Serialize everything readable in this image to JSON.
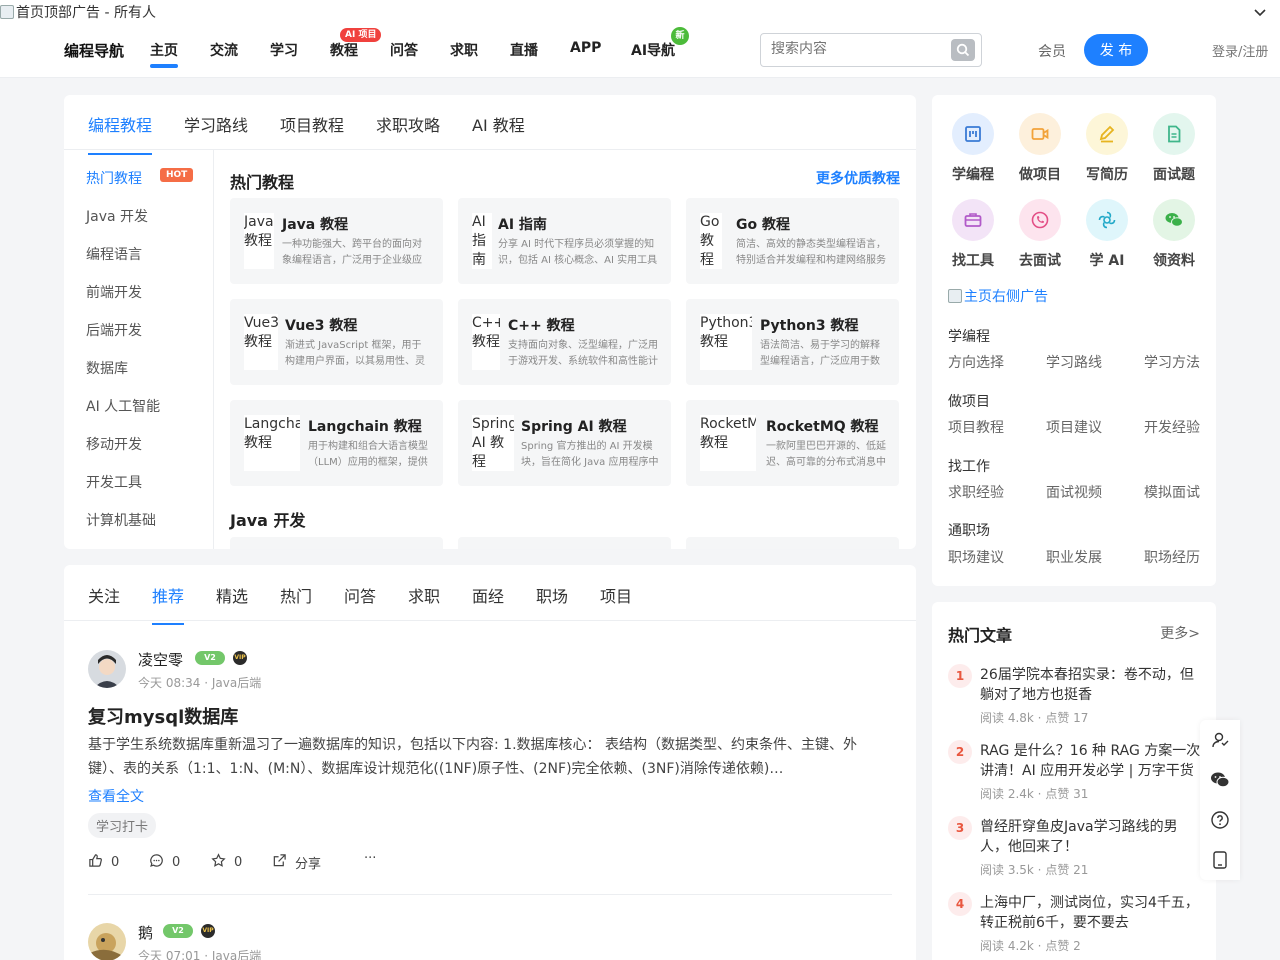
{
  "header": {
    "top_ad_alt": "首页顶部广告 - 所有人",
    "logo": "编程导航",
    "nav": [
      {
        "label": "主页",
        "active": true
      },
      {
        "label": "交流"
      },
      {
        "label": "学习"
      },
      {
        "label": "教程",
        "badge": "AI 项目"
      },
      {
        "label": "问答"
      },
      {
        "label": "求职"
      },
      {
        "label": "直播"
      },
      {
        "label": "APP"
      },
      {
        "label": "AI导航",
        "badge": "新"
      }
    ],
    "search_placeholder": "搜索内容",
    "vip_label": "会员",
    "publish_label": "发 布",
    "login_label": "登录/注册"
  },
  "tutorial": {
    "tabs": [
      "编程教程",
      "学习路线",
      "项目教程",
      "求职攻略",
      "AI 教程"
    ],
    "sidebar": [
      "热门教程",
      "Java 开发",
      "编程语言",
      "前端开发",
      "后端开发",
      "数据库",
      "AI 人工智能",
      "移动开发",
      "开发工具",
      "计算机基础"
    ],
    "hot_badge": "HOT",
    "section_hot": "热门教程",
    "section_java": "Java 开发",
    "more_label": "更多优质教程",
    "items": [
      {
        "thumb": "Java 教程",
        "name": "Java 教程",
        "desc": "一种功能强大、跨平台的面向对象编程语言，广泛用于企业级应用开发"
      },
      {
        "thumb": "AI 指南",
        "name": "AI 指南",
        "desc": "分享 AI 时代下程序员必须掌握的知识，包括 AI 核心概念、AI 实用工具"
      },
      {
        "thumb": "Go 教程",
        "name": "Go 教程",
        "desc": "简洁、高效的静态类型编程语言，特别适合并发编程和构建网络服务"
      },
      {
        "thumb": "Vue3 教程",
        "name": "Vue3 教程",
        "desc": "渐进式 JavaScript 框架，用于构建用户界面，以其易用性、灵活性著称"
      },
      {
        "thumb": "C++ 教程",
        "name": "C++ 教程",
        "desc": "支持面向对象、泛型编程，广泛用于游戏开发、系统软件和高性能计算"
      },
      {
        "thumb": "Python3 教程",
        "name": "Python3 教程",
        "desc": "语法简洁、易于学习的解释型编程语言，广泛应用于数据分析等领域"
      },
      {
        "thumb": "Langchain 教程",
        "name": "Langchain 教程",
        "desc": "用于构建和组合大语言模型（LLM）应用的框架，提供丰富的组件"
      },
      {
        "thumb": "Spring AI 教程",
        "name": "Spring AI 教程",
        "desc": "Spring 官方推出的 AI 开发模块，旨在简化 Java 应用程序中的 AI 集成"
      },
      {
        "thumb": "RocketMQ 教程",
        "name": "RocketMQ 教程",
        "desc": "一款阿里巴巴开源的、低延迟、高可靠的分布式消息中间件"
      }
    ]
  },
  "feed": {
    "tabs": [
      "关注",
      "推荐",
      "精选",
      "热门",
      "问答",
      "求职",
      "面经",
      "职场",
      "项目"
    ],
    "posts": [
      {
        "author": "凌空零",
        "level": "V2",
        "vip": "VIP",
        "time": "今天 08:34",
        "category": "Java后端",
        "title": "复习mysql数据库",
        "body": "基于学生系统数据库重新温习了一遍数据库的知识，包括以下内容: 1.数据库核心： 表结构（数据类型、约束条件、主键、外键）、表的关系（1:1、1:N、(M:N）、数据库设计规范化((1NF)原子性、(2NF)完全依赖、(3NF)消除传递依赖)…",
        "read_more": "查看全文",
        "tag": "学习打卡",
        "likes": "0",
        "comments": "0",
        "stars": "0",
        "share": "分享",
        "more": "···"
      },
      {
        "author": "鹅",
        "level": "V2",
        "vip": "VIP",
        "time": "今天 07:01",
        "category": "Java后端"
      }
    ],
    "meta_sep": "·"
  },
  "quick": {
    "icons": [
      {
        "label": "学编程",
        "icon": "board-icon",
        "bg": "#e3eefe",
        "fg": "#3a7bd5"
      },
      {
        "label": "做项目",
        "icon": "video-icon",
        "bg": "#fdf0dc",
        "fg": "#f2a33a"
      },
      {
        "label": "写简历",
        "icon": "pen-icon",
        "bg": "#fdf6d8",
        "fg": "#e7b421"
      },
      {
        "label": "面试题",
        "icon": "doc-icon",
        "bg": "#e3f6ee",
        "fg": "#3fb68b"
      },
      {
        "label": "找工具",
        "icon": "toolbox-icon",
        "bg": "#f3e4f7",
        "fg": "#b15ac9"
      },
      {
        "label": "去面试",
        "icon": "phone-icon",
        "bg": "#fde4ee",
        "fg": "#e34f86"
      },
      {
        "label": "学 AI",
        "icon": "ai-icon",
        "bg": "#dff6fb",
        "fg": "#23a9c8"
      },
      {
        "label": "领资料",
        "icon": "wechat-icon",
        "bg": "#e3f5e5",
        "fg": "#3bb04a"
      }
    ],
    "right_ad_alt": "主页右侧广告",
    "groups": [
      {
        "title": "学编程",
        "links": [
          "方向选择",
          "学习路线",
          "学习方法"
        ]
      },
      {
        "title": "做项目",
        "links": [
          "项目教程",
          "项目建议",
          "开发经验"
        ]
      },
      {
        "title": "找工作",
        "links": [
          "求职经验",
          "面试视频",
          "模拟面试"
        ]
      },
      {
        "title": "通职场",
        "links": [
          "职场建议",
          "职业发展",
          "职场经历"
        ]
      }
    ]
  },
  "hot": {
    "title": "热门文章",
    "more": "更多>",
    "articles": [
      {
        "rank": "1",
        "title": "26届学院本春招实录：卷不动，但躺对了地方也挺香",
        "reads": "阅读 4.8k",
        "likes": "点赞 17"
      },
      {
        "rank": "2",
        "title": "RAG 是什么？16 种 RAG 方案一次讲清！AI 应用开发必学 | 万字干货",
        "reads": "阅读 2.4k",
        "likes": "点赞 31"
      },
      {
        "rank": "3",
        "title": "曾经肝穿鱼皮Java学习路线的男人，他回来了！",
        "reads": "阅读 3.5k",
        "likes": "点赞 21"
      },
      {
        "rank": "4",
        "title": "上海中厂，测试岗位，实习4千五，转正税前6千，要不要去",
        "reads": "阅读 4.2k",
        "likes": "点赞 2"
      }
    ]
  },
  "colors": {
    "accent": "#1e80ff",
    "hot": "#f56d46"
  }
}
